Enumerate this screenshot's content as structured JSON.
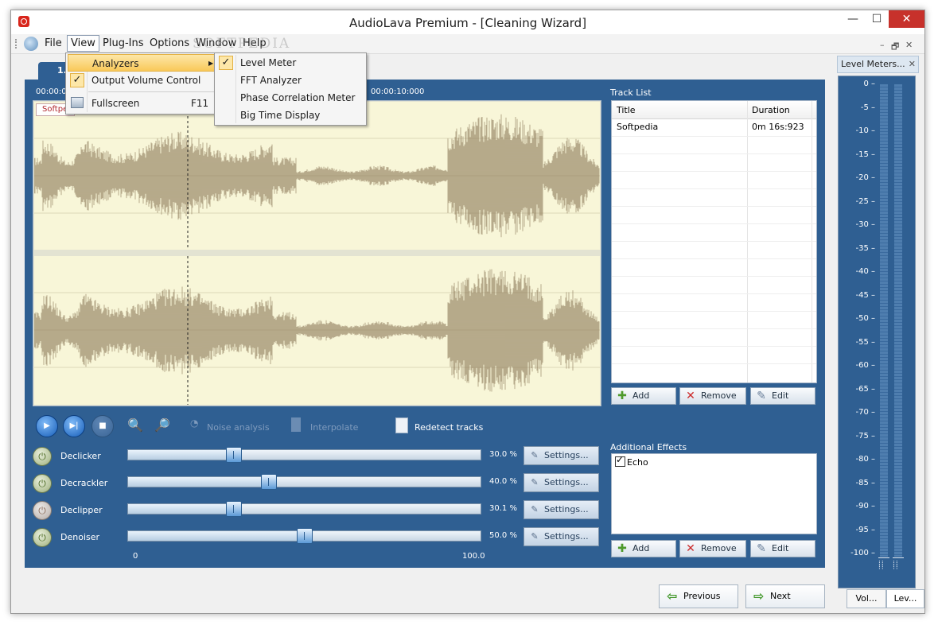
{
  "window": {
    "title": "AudioLava Premium - [Cleaning Wizard]",
    "controls": {
      "minimize": "—",
      "maximize": "☐",
      "close": "✕"
    }
  },
  "menubar": {
    "items": [
      "File",
      "View",
      "Plug-Ins",
      "Options",
      "Window",
      "Help"
    ],
    "active": "View",
    "watermark": "SOFTPEDIA",
    "mdi_controls": [
      "–",
      "🗗",
      "✕"
    ]
  },
  "view_menu": {
    "items": [
      {
        "label": "Analyzers",
        "has_submenu": true
      },
      {
        "label": "Output Volume Control",
        "checked": true
      },
      {
        "label": "Fullscreen",
        "shortcut": "F11"
      }
    ]
  },
  "analyzers_submenu": {
    "items": [
      {
        "label": "Level Meter",
        "checked": true
      },
      {
        "label": "FFT Analyzer"
      },
      {
        "label": "Phase Correlation Meter"
      },
      {
        "label": "Big Time Display"
      }
    ]
  },
  "wizard": {
    "tab_label": "1. In",
    "time_labels": [
      "00:00:0",
      "00:00:10:000"
    ],
    "waveform_tag": "Softpe"
  },
  "track_list": {
    "title": "Track List",
    "columns": [
      "Title",
      "Duration"
    ],
    "rows": [
      {
        "title": "Softpedia",
        "duration": "0m 16s:923"
      }
    ],
    "buttons": {
      "add": "Add",
      "remove": "Remove",
      "edit": "Edit"
    }
  },
  "toolbar": {
    "noise_analysis": "Noise analysis",
    "interpolate": "Interpolate",
    "redetect": "Redetect tracks"
  },
  "effects": [
    {
      "name": "Declicker",
      "value": 30.0,
      "display": "30.0 %",
      "enabled": true,
      "settings": "Settings..."
    },
    {
      "name": "Decrackler",
      "value": 40.0,
      "display": "40.0 %",
      "enabled": true,
      "settings": "Settings..."
    },
    {
      "name": "Declipper",
      "value": 30.1,
      "display": "30.1 %",
      "enabled": false,
      "settings": "Settings..."
    },
    {
      "name": "Denoiser",
      "value": 50.0,
      "display": "50.0 %",
      "enabled": true,
      "settings": "Settings..."
    }
  ],
  "slider_scale": {
    "min": "0",
    "max": "100.0"
  },
  "additional_effects": {
    "title": "Additional Effects",
    "items": [
      {
        "label": "Echo",
        "checked": true
      }
    ],
    "buttons": {
      "add": "Add",
      "remove": "Remove",
      "edit": "Edit"
    }
  },
  "navigation": {
    "previous": "Previous",
    "next": "Next"
  },
  "level_meters": {
    "title": "Level Meters...",
    "scale": [
      "0",
      "-5",
      "-10",
      "-15",
      "-20",
      "-25",
      "-30",
      "-35",
      "-40",
      "-45",
      "-50",
      "-55",
      "-60",
      "-65",
      "-70",
      "-75",
      "-80",
      "-85",
      "-90",
      "-95",
      "-100"
    ],
    "tabs": [
      "Vol...",
      "Lev..."
    ]
  },
  "colors": {
    "panel_blue": "#2f5f92",
    "waveform": "#8b7758",
    "waveform_bg": "#f8f6d8",
    "menu_highlight": "#f9c95a"
  }
}
